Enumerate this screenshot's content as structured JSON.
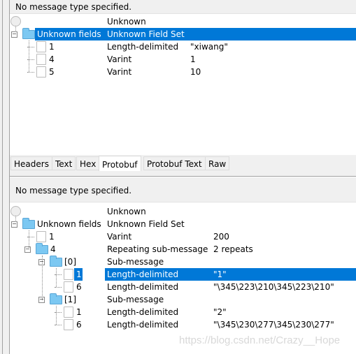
{
  "top_pane": {
    "header": "No message type specified.",
    "rows": [
      {
        "kind": "root",
        "name": "",
        "type": "Unknown",
        "value": ""
      },
      {
        "kind": "folder",
        "level": 0,
        "name": "Unknown fields",
        "type": "Unknown Field Set",
        "value": "",
        "selected": true
      },
      {
        "kind": "doc",
        "level": 1,
        "name": "1",
        "type": "Length-delimited",
        "value": "\"xiwang\""
      },
      {
        "kind": "doc",
        "level": 1,
        "name": "4",
        "type": "Varint",
        "value": "1"
      },
      {
        "kind": "doc",
        "level": 1,
        "name": "5",
        "type": "Varint",
        "value": "10"
      }
    ]
  },
  "tabs": [
    {
      "label": "Headers"
    },
    {
      "label": "Text"
    },
    {
      "label": "Hex"
    },
    {
      "label": "Protobuf",
      "active": true
    },
    {
      "label": "Protobuf Text"
    },
    {
      "label": "Raw"
    }
  ],
  "bottom_pane": {
    "header": "No message type specified.",
    "rows": [
      {
        "kind": "root",
        "name": "",
        "type": "Unknown",
        "value": ""
      },
      {
        "kind": "folder",
        "level": 0,
        "name": "Unknown fields",
        "type": "Unknown Field Set",
        "value": ""
      },
      {
        "kind": "doc",
        "level": 1,
        "name": "1",
        "type": "Varint",
        "value": "200"
      },
      {
        "kind": "folder",
        "level": 1,
        "name": "4",
        "type": "Repeating sub-message",
        "value": "2 repeats"
      },
      {
        "kind": "folder",
        "level": 2,
        "name": "[0]",
        "type": "Sub-message",
        "value": ""
      },
      {
        "kind": "doc",
        "level": 3,
        "name": "1",
        "type": "Length-delimited",
        "value": "\"1\"",
        "selected": true
      },
      {
        "kind": "doc",
        "level": 3,
        "name": "6",
        "type": "Length-delimited",
        "value": "\"\\345\\223\\210\\345\\223\\210\""
      },
      {
        "kind": "folder",
        "level": 2,
        "name": "[1]",
        "type": "Sub-message",
        "value": ""
      },
      {
        "kind": "doc",
        "level": 3,
        "name": "1",
        "type": "Length-delimited",
        "value": "\"2\""
      },
      {
        "kind": "doc",
        "level": 3,
        "name": "6",
        "type": "Length-delimited",
        "value": "\"\\345\\230\\277\\345\\230\\277\""
      }
    ]
  },
  "watermark": "https://blog.csdn.net/Crazy__Hope",
  "colors": {
    "selection": "#0078d7",
    "header_bg": "#f0f0f0"
  }
}
